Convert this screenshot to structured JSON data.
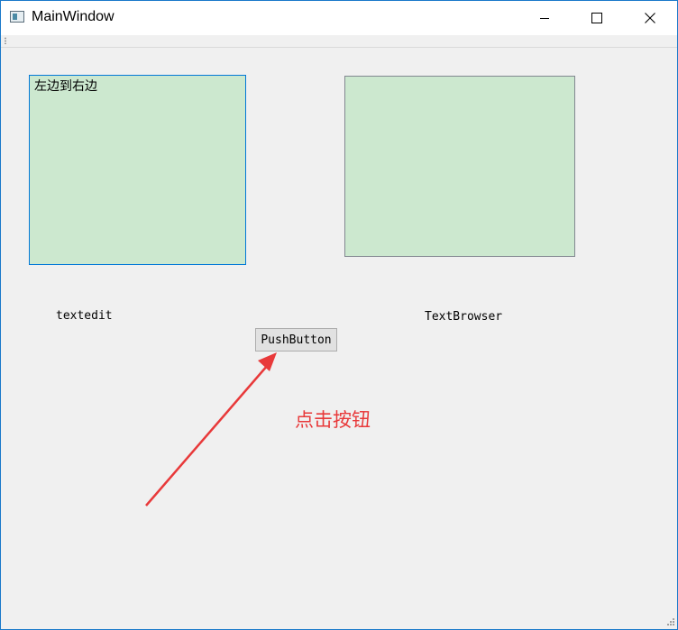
{
  "window": {
    "title": "MainWindow",
    "icon": "app-window-icon",
    "controls": [
      "minimize-icon",
      "maximize-icon",
      "close-icon"
    ]
  },
  "textedit": {
    "value": "左边到右边",
    "background": "#cce8cf",
    "focus_border": "#0078d7"
  },
  "textbrowser": {
    "value": "",
    "background": "#cce8cf"
  },
  "labels": {
    "textedit": "textedit",
    "textbrowser": "TextBrowser"
  },
  "push_button": {
    "label": "PushButton"
  },
  "annotation": {
    "text": "点击按钮",
    "color": "#e8393a"
  }
}
